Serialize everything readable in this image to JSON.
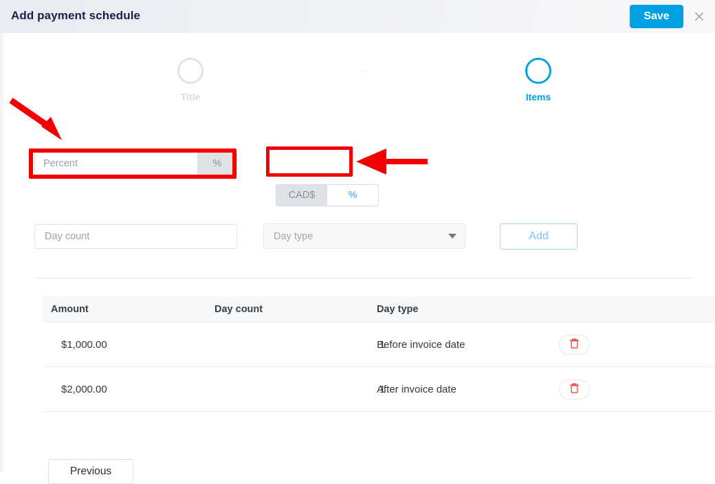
{
  "header": {
    "title": "Add payment schedule",
    "save_label": "Save",
    "close_icon": "close-icon",
    "accent_color": "#00a0e3"
  },
  "stepper": {
    "steps": [
      {
        "label": "Title",
        "active": false
      },
      {
        "label": "Items",
        "active": true
      }
    ]
  },
  "form": {
    "percent": {
      "value": "",
      "placeholder": "Percent",
      "addon_label": "%"
    },
    "currency_toggle": {
      "options": [
        {
          "label": "CAD$",
          "active": false
        },
        {
          "label": "%",
          "active": true
        }
      ]
    },
    "day_count": {
      "value": "",
      "placeholder": "Day count"
    },
    "day_type": {
      "selected": "Day type",
      "caret_icon": "chevron-down-icon"
    },
    "add_label": "Add"
  },
  "table": {
    "columns": [
      "Amount",
      "Day count",
      "Day type",
      ""
    ],
    "rows": [
      {
        "amount": "$1,000.00",
        "day_count": "1",
        "day_type": "Before invoice date",
        "delete_icon": "trash-icon"
      },
      {
        "amount": "$2,000.00",
        "day_count": "1",
        "day_type": "After invoice date",
        "delete_icon": "trash-icon"
      }
    ]
  },
  "footer": {
    "previous_label": "Previous"
  },
  "annotations": {
    "arrow_color": "#f50000",
    "highlight_color": "#f50000",
    "items": [
      {
        "name": "arrow-to-percent-field",
        "direction": "down-right"
      },
      {
        "name": "arrow-to-currency-toggle",
        "direction": "left"
      },
      {
        "name": "highlight-percent-field"
      },
      {
        "name": "highlight-currency-toggle"
      }
    ]
  }
}
